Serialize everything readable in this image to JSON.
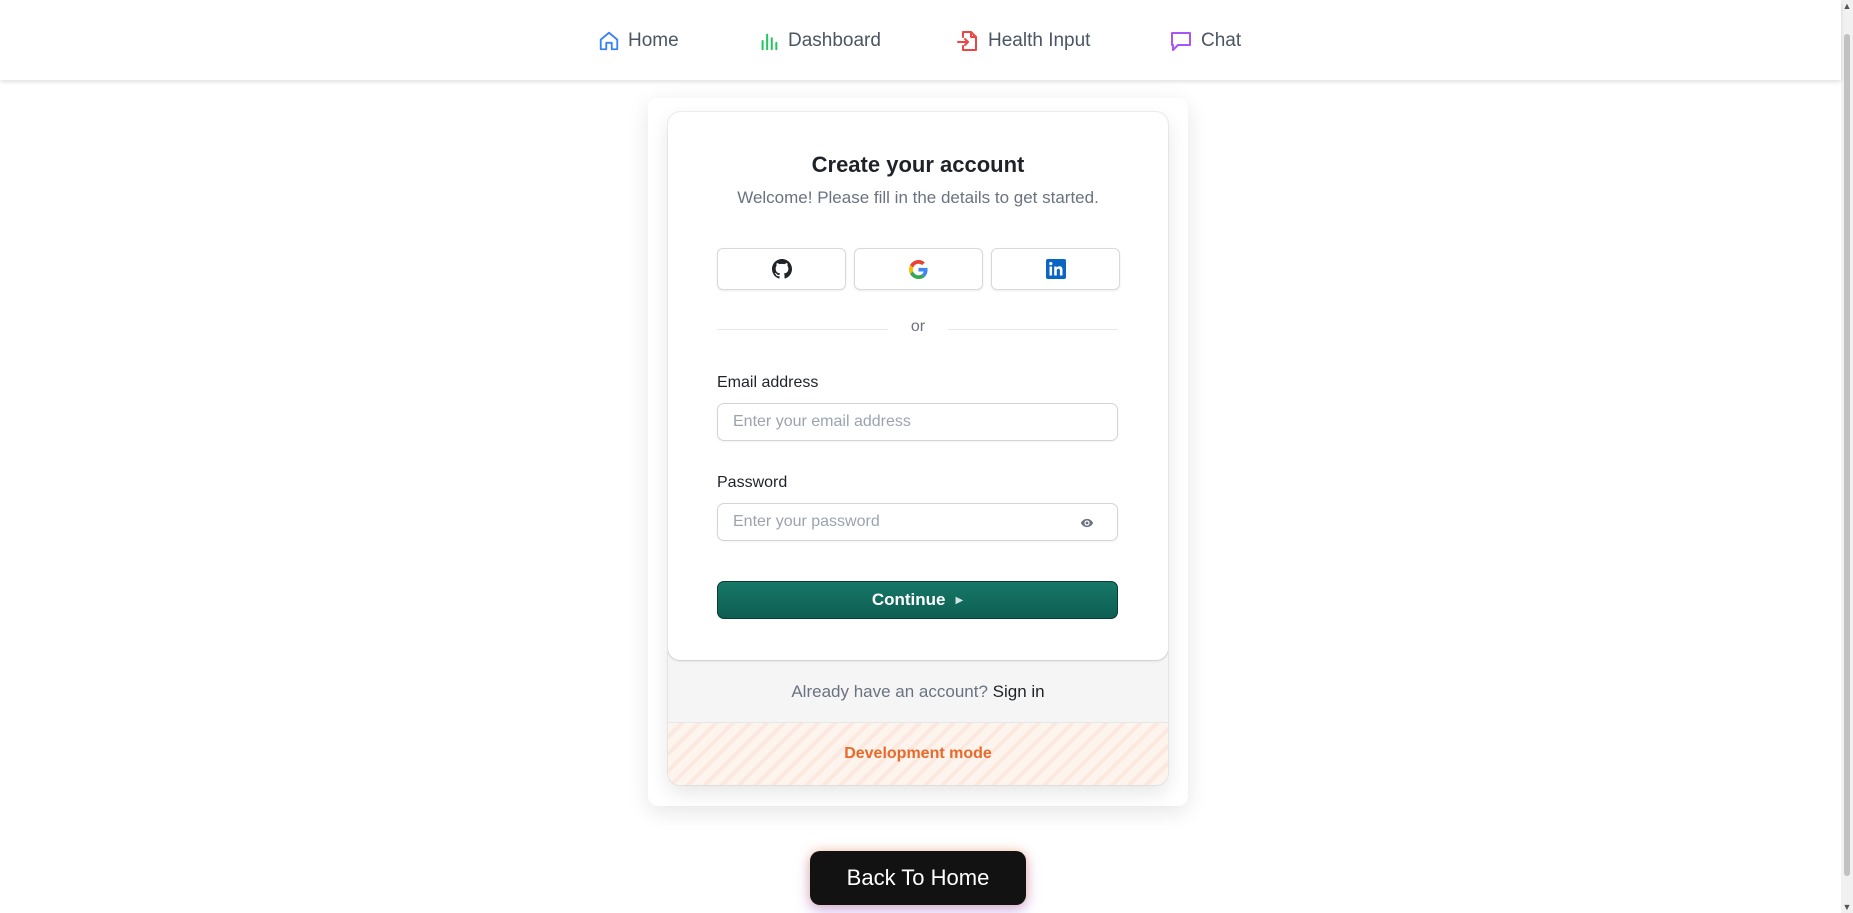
{
  "nav": {
    "items": [
      {
        "label": "Home",
        "icon": "home-icon",
        "color": "#3b82f6"
      },
      {
        "label": "Dashboard",
        "icon": "bar-chart-icon",
        "color": "#22c55e"
      },
      {
        "label": "Health Input",
        "icon": "file-input-icon",
        "color": "#ef4444"
      },
      {
        "label": "Chat",
        "icon": "chat-bubble-icon",
        "color": "#a855f7"
      }
    ]
  },
  "card": {
    "title": "Create your account",
    "subtitle": "Welcome! Please fill in the details to get started.",
    "social": [
      {
        "name": "github",
        "icon": "github-icon"
      },
      {
        "name": "google",
        "icon": "google-icon"
      },
      {
        "name": "linkedin",
        "icon": "linkedin-icon",
        "color": "#0a66c2"
      }
    ],
    "divider_text": "or",
    "email": {
      "label": "Email address",
      "placeholder": "Enter your email address",
      "value": ""
    },
    "password": {
      "label": "Password",
      "placeholder": "Enter your password",
      "value": ""
    },
    "continue_label": "Continue",
    "continue_color": "#0f6b5c"
  },
  "footer": {
    "signin_prompt": "Already have an account?",
    "signin_link": "Sign in",
    "dev_mode": "Development mode",
    "dev_mode_color": "#e8692a"
  },
  "back_button": "Back To Home"
}
